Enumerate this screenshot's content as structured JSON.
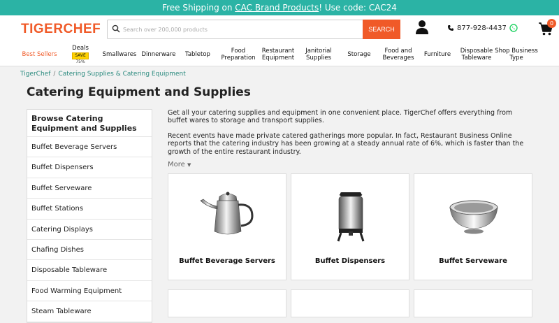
{
  "promo": {
    "prefix": "Free Shipping on ",
    "link": "CAC Brand Products",
    "suffix": "! Use code: CAC24"
  },
  "header": {
    "logo": "TIGERCHEF",
    "search_placeholder": "Search over 200,000 products",
    "search_button": "SEARCH",
    "phone": "877-928-4437",
    "cart_count": "0"
  },
  "nav": {
    "best_sellers": "Best Sellers",
    "deals": "Deals",
    "deals_save": "SAVE",
    "deals_pct": "75%",
    "items": [
      {
        "line1": "Smallwares",
        "line2": ""
      },
      {
        "line1": "Dinnerware",
        "line2": ""
      },
      {
        "line1": "Tabletop",
        "line2": ""
      },
      {
        "line1": "Food",
        "line2": "Preparation"
      },
      {
        "line1": "Restaurant",
        "line2": "Equipment"
      },
      {
        "line1": "Janitorial",
        "line2": "Supplies"
      },
      {
        "line1": "Storage",
        "line2": ""
      },
      {
        "line1": "Food and",
        "line2": "Beverages"
      },
      {
        "line1": "Furniture",
        "line2": ""
      },
      {
        "line1": "Disposable",
        "line2": "Tableware"
      },
      {
        "line1": "Shop Business",
        "line2": "Type"
      }
    ]
  },
  "breadcrumb": {
    "home": "TigerChef",
    "sep": "/",
    "current": "Catering Supplies & Catering Equipment"
  },
  "page_title": "Catering Equipment and Supplies",
  "sidebar": {
    "heading": "Browse Catering Equipment and Supplies",
    "items": [
      "Buffet Beverage Servers",
      "Buffet Dispensers",
      "Buffet Serveware",
      "Buffet Stations",
      "Catering Displays",
      "Chafing Dishes",
      "Disposable Tableware",
      "Food Warming Equipment",
      "Steam Tableware"
    ]
  },
  "description": {
    "p1": "Get all your catering supplies and equipment in one convenient place. TigerChef offers everything from buffet wares to storage and transport supplies.",
    "p2": "Recent events have made private catered gatherings more popular. In fact, Restaurant Business Online reports that the catering industry has been growing at a steady annual rate of 6%, which is faster than the growth of the entire restaurant industry.",
    "more": "More"
  },
  "cards": [
    {
      "label": "Buffet Beverage Servers",
      "icon": "teapot-icon"
    },
    {
      "label": "Buffet Dispensers",
      "icon": "dispenser-icon"
    },
    {
      "label": "Buffet Serveware",
      "icon": "bowl-icon"
    }
  ],
  "colors": {
    "brand": "#f05a28",
    "promo": "#2bb3a5",
    "link": "#2a8a7e"
  }
}
